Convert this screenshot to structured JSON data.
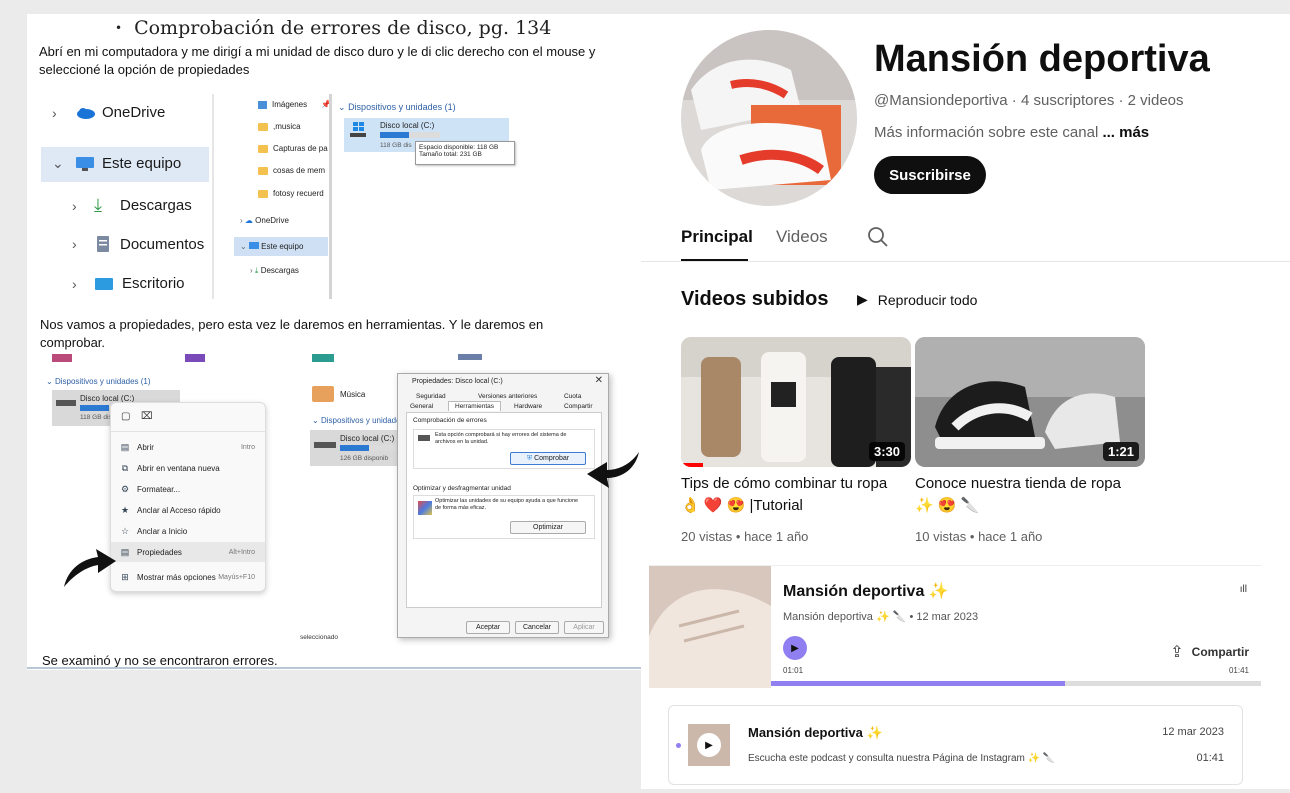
{
  "document": {
    "bullet_heading": "Comprobación de errores de disco, pg. 134",
    "para1": "Abrí en mi computadora y me dirigí a mi unidad de disco duro y le di clic derecho con el mouse y seleccioné la opción de propiedades",
    "para2": "Nos vamos a propiedades, pero esta vez le daremos en herramientas. Y le daremos en comprobar.",
    "para3": "Se examinó y no se encontraron errores.",
    "nav_large": [
      "OneDrive",
      "Este equipo",
      "Descargas",
      "Documentos",
      "Escritorio"
    ],
    "quick_access": [
      "Imágenes",
      ",musica",
      "Capturas de pa",
      "cosas de mem",
      "fotosy recuerd"
    ],
    "nav_small": [
      "OneDrive",
      "Este equipo",
      "Descargas"
    ],
    "devices_header": "Dispositivos y unidades (1)",
    "drive_name": "Disco local (C:)",
    "drive_free_short": "118 GB dis",
    "drive_free_short2": "118 GB disp",
    "drive_free_short3": "126 GB disponib",
    "drive_used_fraction": 0.49,
    "tooltip_free": "Espacio disponible: 118 GB",
    "tooltip_total": "Tamaño total: 231 GB",
    "context_menu": [
      {
        "label": "Abrir",
        "shortcut": "Intro"
      },
      {
        "label": "Abrir en ventana nueva",
        "shortcut": ""
      },
      {
        "label": "Formatear...",
        "shortcut": ""
      },
      {
        "label": "Anclar al Acceso rápido",
        "shortcut": ""
      },
      {
        "label": "Anclar a Inicio",
        "shortcut": ""
      },
      {
        "label": "Propiedades",
        "shortcut": "Alt+Intro"
      },
      {
        "label": "Mostrar más opciones",
        "shortcut": "Mayús+F10"
      }
    ],
    "music_folder": "Música",
    "selected_text": "seleccionado",
    "dialog": {
      "title": "Propiedades: Disco local (C:)",
      "tabs_row1": [
        "Seguridad",
        "Versiones anteriores",
        "Cuota"
      ],
      "tabs_row2": [
        "General",
        "Herramientas",
        "Hardware",
        "Compartir"
      ],
      "group1": "Comprobación de errores",
      "group1_text": "Esta opción comprobará si hay errores del sistema de archivos en la unidad.",
      "check_button": "Comprobar",
      "group2": "Optimizar y desfragmentar unidad",
      "group2_text": "Optimizar las unidades de su equipo ayuda a que funcione de forma más eficaz.",
      "optimize_button": "Optimizar",
      "ok": "Aceptar",
      "cancel": "Cancelar",
      "apply": "Aplicar"
    }
  },
  "channel": {
    "name": "Mansión deportiva",
    "handle_meta": "@Mansiondeportiva · 4 suscriptores · 2 videos",
    "more_info": "Más información sobre este canal",
    "more_link": "... más",
    "subscribe": "Suscribirse",
    "tabs": [
      "Principal",
      "Videos"
    ],
    "section_title": "Videos subidos",
    "play_all": "Reproducir todo",
    "videos": [
      {
        "title": "Tips de cómo combinar tu ropa 👌 ❤️ 😍 |Tutorial",
        "duration": "3:30",
        "meta": "20 vistas • hace 1 año"
      },
      {
        "title": "Conoce nuestra tienda de ropa ✨ 😍 🔪",
        "duration": "1:21",
        "meta": "10 vistas • hace 1 año"
      }
    ]
  },
  "podcast": {
    "title": "Mansión deportiva ✨",
    "subtitle": "Mansión deportiva ✨ 🔪 • 12 mar 2023",
    "share": "Compartir",
    "time_current": "01:01",
    "time_total": "01:41",
    "progress_fraction": 0.6,
    "episode": {
      "title": "Mansión deportiva ✨",
      "date": "12 mar 2023",
      "description": "Escucha este podcast y consulta nuestra Página de Instagram ✨ 🔪",
      "duration": "01:41"
    }
  },
  "colors": {
    "drive_blue": "#2b79d3",
    "podcast_purple": "#8f7ff0",
    "yt_red": "#ff0000"
  }
}
